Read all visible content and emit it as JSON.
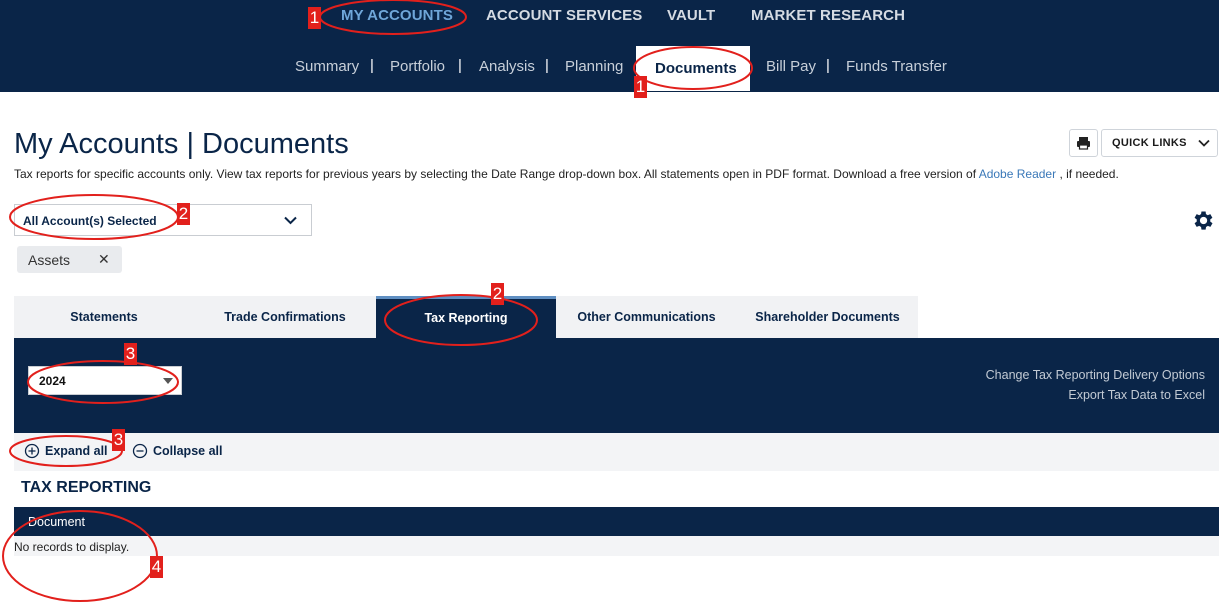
{
  "top_nav": {
    "main_items": [
      "MY ACCOUNTS",
      "ACCOUNT SERVICES",
      "VAULT",
      "MARKET RESEARCH"
    ],
    "active_main": "MY ACCOUNTS",
    "sub_items": [
      "Summary",
      "Portfolio",
      "Analysis",
      "Planning",
      "Documents",
      "Bill Pay",
      "Funds Transfer"
    ],
    "active_sub": "Documents",
    "separator": "|"
  },
  "page": {
    "title": "My Accounts | Documents",
    "description": "Tax reports for specific accounts only. View tax reports for previous years by selecting the Date Range drop-down box. All statements open in PDF format. Download a free version of",
    "link_text": "Adobe Reader",
    "description_suffix": ", if needed."
  },
  "toolbar": {
    "print_icon": "printer-icon",
    "quick_links_label": "QUICK LINKS"
  },
  "account_select": {
    "value": "All Account(s) Selected"
  },
  "chip": {
    "label": "Assets",
    "remove": "✕"
  },
  "tabs": [
    {
      "label": "Statements",
      "active": false
    },
    {
      "label": "Trade Confirmations",
      "active": false
    },
    {
      "label": "Tax Reporting",
      "active": true
    },
    {
      "label": "Other Communications",
      "active": false
    },
    {
      "label": "Shareholder Documents",
      "active": false
    }
  ],
  "filter": {
    "year": "2024",
    "link_delivery": "Change Tax Reporting Delivery Options",
    "link_export": "Export Tax Data to Excel"
  },
  "expand": {
    "expand_all": "Expand all",
    "collapse_all": "Collapse all"
  },
  "section": {
    "title": "TAX REPORTING",
    "column_header": "Document",
    "empty_text": "No records to display."
  },
  "annotations": {
    "labels": [
      "1",
      "1",
      "2",
      "2",
      "3",
      "3",
      "4"
    ],
    "color": "#e2201c"
  },
  "colors": {
    "navy": "#0a2548",
    "accent_link": "#3a78b8",
    "active_main": "#6fa6d9"
  }
}
